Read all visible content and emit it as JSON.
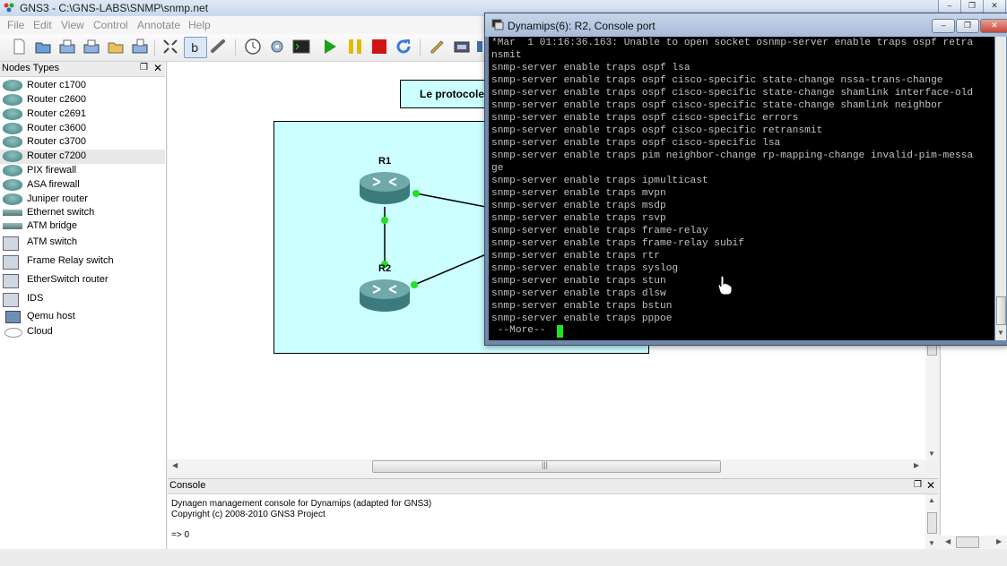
{
  "window": {
    "title": "GNS3 - C:\\GNS-LABS\\SNMP\\snmp.net"
  },
  "menu": [
    "File",
    "Edit",
    "View",
    "Control",
    "Annotate",
    "Help"
  ],
  "toolbar": {
    "icons": [
      "new-file-icon",
      "open-icon",
      "save-icon",
      "save-as-icon",
      "open-project-icon",
      "export-icon",
      "design-mode-icon",
      "emulation-mode-icon",
      "link-icon",
      "clock-icon",
      "settings-icon",
      "console-icon",
      "start-icon",
      "pause-icon",
      "stop-icon",
      "reload-icon",
      "note-icon",
      "screenshot-icon"
    ],
    "colors": {
      "start": "#1aa21a",
      "pause": "#e8b800",
      "stop": "#d01414"
    }
  },
  "nodes_panel": {
    "title": "Nodes Types",
    "items": [
      {
        "label": "Router c1700",
        "icon": "router-icon"
      },
      {
        "label": "Router c2600",
        "icon": "router-icon"
      },
      {
        "label": "Router c2691",
        "icon": "router-icon"
      },
      {
        "label": "Router c3600",
        "icon": "router-icon"
      },
      {
        "label": "Router c3700",
        "icon": "router-icon"
      },
      {
        "label": "Router c7200",
        "icon": "router-icon"
      },
      {
        "label": "PIX firewall",
        "icon": "firewall-icon"
      },
      {
        "label": "ASA firewall",
        "icon": "firewall-icon"
      },
      {
        "label": "Juniper router",
        "icon": "router-icon"
      },
      {
        "label": "Ethernet switch",
        "icon": "switch-icon"
      },
      {
        "label": "ATM bridge",
        "icon": "bridge-icon"
      },
      {
        "label": "ATM switch",
        "icon": "atm-switch-icon"
      },
      {
        "label": "Frame Relay switch",
        "icon": "frame-relay-icon"
      },
      {
        "label": "EtherSwitch router",
        "icon": "etherswitch-icon"
      },
      {
        "label": "IDS",
        "icon": "ids-icon"
      },
      {
        "label": "Qemu host",
        "icon": "host-icon"
      },
      {
        "label": "Cloud",
        "icon": "cloud-icon"
      }
    ]
  },
  "topology": {
    "label": "Le protocole",
    "routers": [
      {
        "name": "R1"
      },
      {
        "name": "R2"
      }
    ]
  },
  "terminal": {
    "title": "Dynamips(6): R2, Console port",
    "lines": [
      "*Mar  1 01:16:36.163: Unable to open socket osnmp-server enable traps ospf retra",
      "nsmit",
      "snmp-server enable traps ospf lsa",
      "snmp-server enable traps ospf cisco-specific state-change nssa-trans-change",
      "snmp-server enable traps ospf cisco-specific state-change shamlink interface-old",
      "snmp-server enable traps ospf cisco-specific state-change shamlink neighbor",
      "snmp-server enable traps ospf cisco-specific errors",
      "snmp-server enable traps ospf cisco-specific retransmit",
      "snmp-server enable traps ospf cisco-specific lsa",
      "snmp-server enable traps pim neighbor-change rp-mapping-change invalid-pim-messa",
      "ge",
      "snmp-server enable traps ipmulticast",
      "snmp-server enable traps mvpn",
      "snmp-server enable traps msdp",
      "snmp-server enable traps rsvp",
      "snmp-server enable traps frame-relay",
      "snmp-server enable traps frame-relay subif",
      "snmp-server enable traps rtr",
      "snmp-server enable traps syslog",
      "snmp-server enable traps stun",
      "snmp-server enable traps dlsw",
      "snmp-server enable traps bstun",
      "snmp-server enable traps pppoe"
    ],
    "more_prompt": " --More--",
    "cursor_color": "#1ee31e"
  },
  "console": {
    "title": "Console",
    "lines": [
      "Dynagen management console for Dynamips (adapted for GNS3)",
      "Copyright (c) 2008-2010 GNS3 Project",
      "",
      "=> 0"
    ]
  }
}
